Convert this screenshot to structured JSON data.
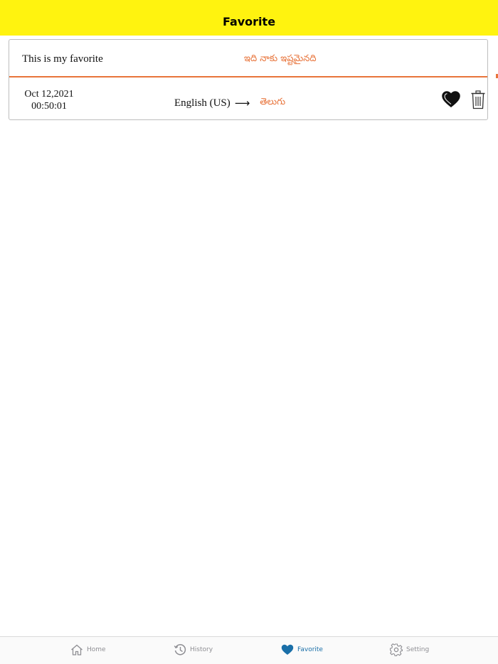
{
  "header": {
    "title": "Favorite",
    "background": "#fff30f"
  },
  "favorite_item": {
    "source_text": "This is my favorite",
    "translated_text": "ఇది నాకు ఇష్టమైనది",
    "date": "Oct 12,2021",
    "time": "00:50:01",
    "source_language": "English (US)",
    "arrow": "⟶",
    "target_language": "తెలుగు",
    "accent_color": "#e8743b"
  },
  "icons": {
    "favorite": "heart-icon",
    "delete": "trash-icon"
  },
  "tabbar": {
    "tabs": [
      {
        "label": "Home",
        "icon": "home-icon"
      },
      {
        "label": "History",
        "icon": "history-icon"
      },
      {
        "label": "Favorite",
        "icon": "heart-icon"
      },
      {
        "label": "Setting",
        "icon": "gear-icon"
      }
    ],
    "active_color": "#1a6fa8",
    "inactive_color": "#8e8e93"
  }
}
